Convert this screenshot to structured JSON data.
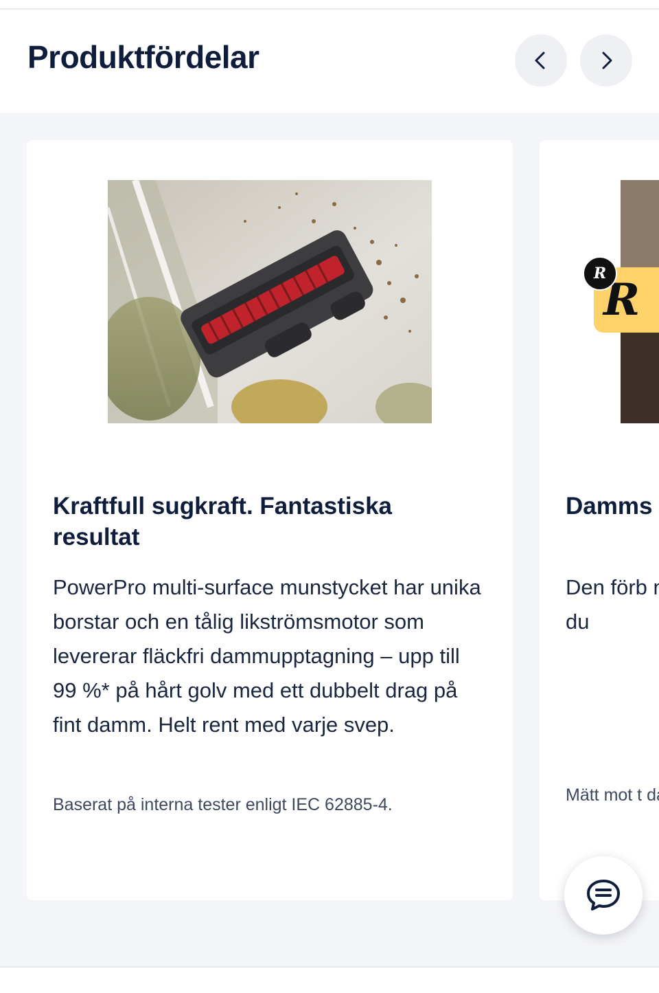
{
  "section": {
    "title": "Produktfördelar"
  },
  "nav": {
    "prev_icon": "chevron-left-icon",
    "next_icon": "chevron-right-icon"
  },
  "cards": [
    {
      "image_alt": "PowerPro multi-surface nozzle picking up debris",
      "title": "Kraftfull sugkraft. Fantastiska resultat",
      "text": "PowerPro multi-surface munstycket har unika borstar och en tålig likströmsmotor som levererar fläckfri dammupptagning – upp till 99 %* på hårt golv med ett dubbelt drag på fint damm. Helt rent med varje svep.",
      "note": "Baserat på interna tester enligt IEC 62885-4."
    },
    {
      "image_alt": "Dust container image",
      "title": "Damms filtret",
      "text": "Den förb minimerc ger bibeh Dammsu innan du",
      "note": "Mätt mot t dammbeh (standard"
    }
  ],
  "badge": {
    "letter": "R",
    "dot_letter": "R",
    "color": "#ffd26a"
  },
  "chat": {
    "icon": "chat-bubble-icon"
  },
  "colors": {
    "title": "#0f1d3c",
    "nav_bg": "#eef0f3",
    "carousel_bg": "#f4f5f8"
  }
}
